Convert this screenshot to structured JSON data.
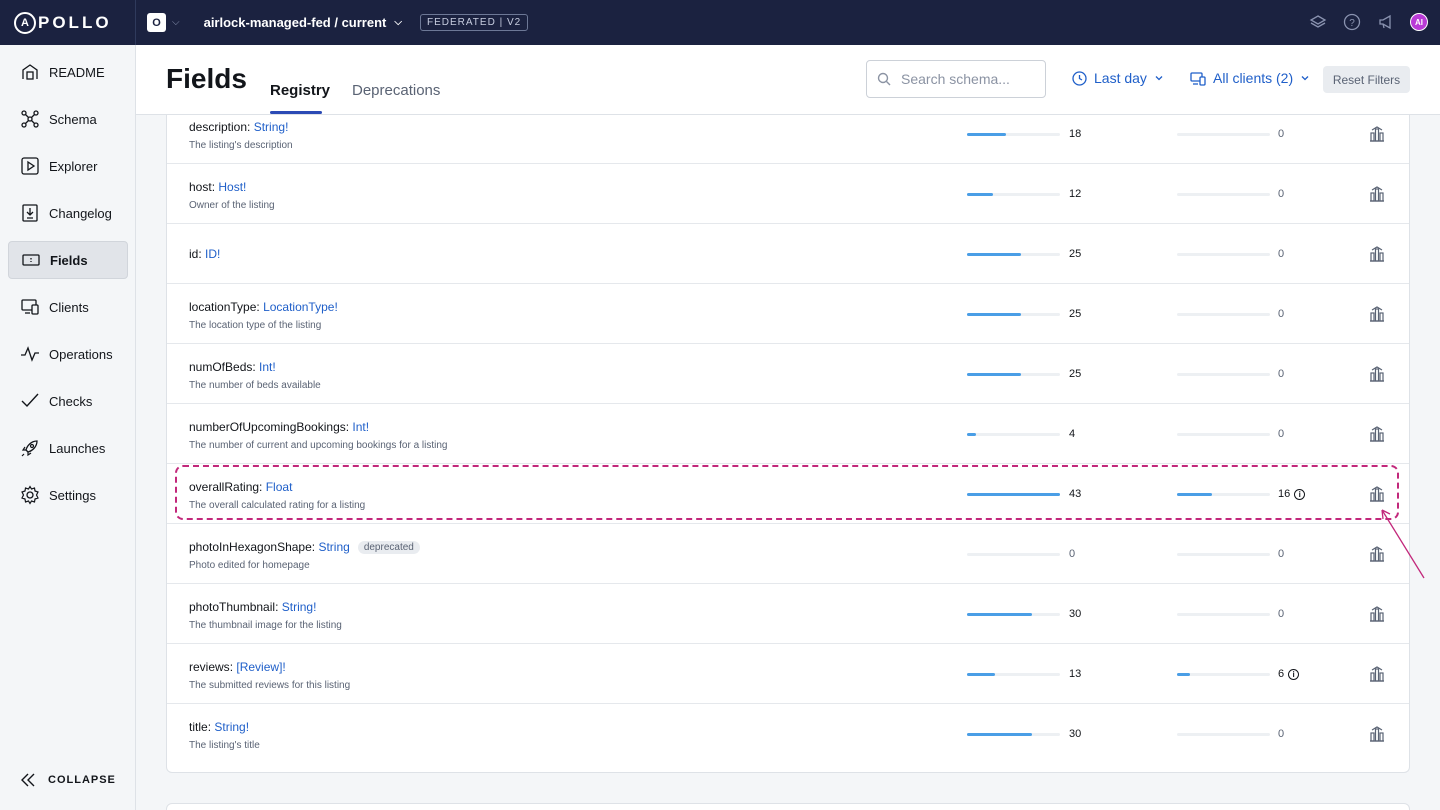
{
  "topbar": {
    "logo_text": "POLLO",
    "logo_letter": "A",
    "org_initial": "O",
    "graph_name": "airlock-managed-fed / current",
    "graph_badge": "FEDERATED | V2",
    "avatar_initials": "AI",
    "icons": [
      "layers-icon",
      "help-icon",
      "megaphone-icon",
      "avatar"
    ]
  },
  "sidebar": {
    "items": [
      {
        "label": "README",
        "icon": "readme-icon"
      },
      {
        "label": "Schema",
        "icon": "schema-icon"
      },
      {
        "label": "Explorer",
        "icon": "explorer-icon"
      },
      {
        "label": "Changelog",
        "icon": "changelog-icon"
      },
      {
        "label": "Fields",
        "icon": "fields-icon",
        "active": true
      },
      {
        "label": "Clients",
        "icon": "clients-icon"
      },
      {
        "label": "Operations",
        "icon": "operations-icon"
      },
      {
        "label": "Checks",
        "icon": "checks-icon"
      },
      {
        "label": "Launches",
        "icon": "launches-icon"
      },
      {
        "label": "Settings",
        "icon": "settings-icon"
      }
    ],
    "collapse_label": "COLLAPSE"
  },
  "header": {
    "title": "Fields",
    "tabs": [
      {
        "label": "Registry",
        "active": true
      },
      {
        "label": "Deprecations",
        "active": false
      }
    ],
    "search_placeholder": "Search schema...",
    "time_filter": "Last day",
    "client_filter": "All clients (2)",
    "reset_label": "Reset Filters"
  },
  "colors": {
    "topbar": "#1b2240",
    "type_link": "#1f5fc9",
    "bar_fill": "#4a9ee6",
    "highlight": "#c2287b"
  },
  "max_requests": 43,
  "fields": [
    {
      "name": "description",
      "type_pre": "",
      "type": "String",
      "suffix": "!",
      "description": "The listing's description",
      "requests": "18",
      "requests_value": 18,
      "clients": "0",
      "clients_value": 0,
      "info": false,
      "deprecated": ""
    },
    {
      "name": "host",
      "type_pre": "",
      "type": "Host",
      "suffix": "!",
      "description": "Owner of the listing",
      "requests": "12",
      "requests_value": 12,
      "clients": "0",
      "clients_value": 0,
      "info": false,
      "deprecated": ""
    },
    {
      "name": "id",
      "type_pre": "",
      "type": "ID",
      "suffix": "!",
      "description": "",
      "requests": "25",
      "requests_value": 25,
      "clients": "0",
      "clients_value": 0,
      "info": false,
      "deprecated": ""
    },
    {
      "name": "locationType",
      "type_pre": "",
      "type": "LocationType",
      "suffix": "!",
      "description": "The location type of the listing",
      "requests": "25",
      "requests_value": 25,
      "clients": "0",
      "clients_value": 0,
      "info": false,
      "deprecated": ""
    },
    {
      "name": "numOfBeds",
      "type_pre": "",
      "type": "Int",
      "suffix": "!",
      "description": "The number of beds available",
      "requests": "25",
      "requests_value": 25,
      "clients": "0",
      "clients_value": 0,
      "info": false,
      "deprecated": ""
    },
    {
      "name": "numberOfUpcomingBookings",
      "type_pre": "",
      "type": "Int",
      "suffix": "!",
      "description": "The number of current and upcoming bookings for a listing",
      "requests": "4",
      "requests_value": 4,
      "clients": "0",
      "clients_value": 0,
      "info": false,
      "deprecated": ""
    },
    {
      "name": "overallRating",
      "type_pre": "",
      "type": "Float",
      "suffix": "",
      "description": "The overall calculated rating for a listing",
      "requests": "43",
      "requests_value": 43,
      "clients": "16",
      "clients_value": 16,
      "info": true,
      "deprecated": ""
    },
    {
      "name": "photoInHexagonShape",
      "type_pre": "",
      "type": "String",
      "suffix": "",
      "description": "Photo edited for homepage",
      "requests": "0",
      "requests_value": 0,
      "clients": "0",
      "clients_value": 0,
      "info": false,
      "deprecated": "deprecated"
    },
    {
      "name": "photoThumbnail",
      "type_pre": "",
      "type": "String",
      "suffix": "!",
      "description": "The thumbnail image for the listing",
      "requests": "30",
      "requests_value": 30,
      "clients": "0",
      "clients_value": 0,
      "info": false,
      "deprecated": ""
    },
    {
      "name": "reviews",
      "type_pre": "[",
      "type": "Review",
      "suffix": "]!",
      "description": "The submitted reviews for this listing",
      "requests": "13",
      "requests_value": 13,
      "clients": "6",
      "clients_value": 6,
      "info": true,
      "deprecated": ""
    },
    {
      "name": "title",
      "type_pre": "",
      "type": "String",
      "suffix": "!",
      "description": "The listing's title",
      "requests": "30",
      "requests_value": 30,
      "clients": "0",
      "clients_value": 0,
      "info": false,
      "deprecated": ""
    }
  ]
}
